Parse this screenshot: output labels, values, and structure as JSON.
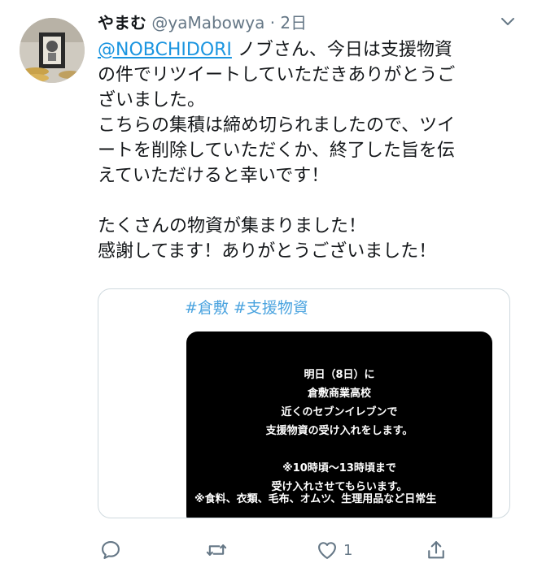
{
  "tweet": {
    "display_name": "やまむ",
    "handle": "@yaMabowya",
    "separator": "·",
    "time": "2日",
    "mention": "@NOBCHIDORI",
    "lines": [
      "ノブさん、今日は支援物資",
      "の件でリツイートしていただきありがとうご",
      "ざいました。",
      "こちらの集積は締め切られましたので、ツイ",
      "ートを削除していただくか、終了した旨を伝",
      "えていただけると幸いです！",
      "",
      "たくさんの物資が集まりました！",
      "感謝してます！ありがとうございました！"
    ]
  },
  "quoted": {
    "hashtags": [
      "#倉敷",
      "#支援物資"
    ],
    "image_lines": [
      "明日（8日）に",
      "倉敷商業高校",
      "近くのセブンイレブンで",
      "支援物資の受け入れをします。",
      "",
      "※10時頃〜13時頃まで",
      "受け入れさせてもらいます。"
    ],
    "image_cut_line": "※食料、衣類、毛布、オムツ、生理用品など日常生"
  },
  "actions": {
    "reply_icon": "reply-icon",
    "retweet_icon": "retweet-icon",
    "like_icon": "heart-icon",
    "like_count": "1",
    "share_icon": "share-icon"
  },
  "colors": {
    "link": "#1b95e0",
    "hashtag": "#4aa3df",
    "muted": "#657786",
    "text": "#14171a"
  }
}
